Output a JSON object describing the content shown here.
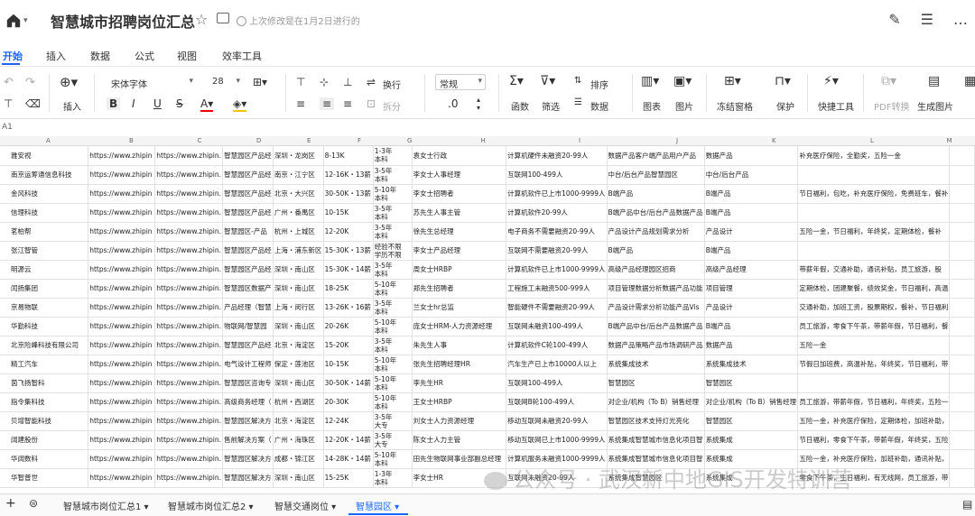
{
  "title": "智慧城市招聘岗位汇总",
  "save_status": "上次修改是在1月2日进行的",
  "menu": [
    "开始",
    "插入",
    "数据",
    "公式",
    "视图",
    "效率工具"
  ],
  "toolbar": {
    "insert": "插入",
    "font": "宋体字体",
    "size": "28",
    "wrap": "换行",
    "split": "拆分",
    "format": "常规",
    "decimal": ".0",
    "func": "函数",
    "filter": "筛选",
    "sort": "排序",
    "data": "数据",
    "chart": "图表",
    "image": "图片",
    "freeze": "冻结窗格",
    "protect": "保护",
    "quick": "快捷工具",
    "pdf": "PDF转换",
    "genimg": "生成图片"
  },
  "cell_ref": "A1",
  "columns": [
    "A",
    "B",
    "C",
    "D",
    "E",
    "F",
    "G",
    "H",
    "I",
    "J",
    "K",
    "L",
    "M"
  ],
  "rows": [
    [
      "雅安视",
      "https://www.zhipin",
      "https://www.zhipin.",
      "智慧园区产品经",
      "深圳・龙岗区",
      "8-13K",
      "1-3年\n本科",
      "袁女士行政",
      "计算机硬件未融资20-99人",
      "数据产品客户端产品用户产品",
      "数据产品",
      "补充医疗保险，全勤奖，五险一金",
      ""
    ],
    [
      "南京运筹通信息科技",
      "https://www.zhipin",
      "https://www.zhipin.",
      "智慧园区产品经",
      "南京・江宁区",
      "12-16K・13薪",
      "3-5年\n本科",
      "李女士人事经理",
      "互联网100-499人",
      "中台/后台产品智慧园区",
      "中台/后台产品",
      "",
      ""
    ],
    [
      "金风科技",
      "https://www.zhipin",
      "https://www.zhipin.",
      "智慧园区产品经",
      "北京・大兴区",
      "30-50K・13薪",
      "5-10年\n本科",
      "李女士招聘者",
      "计算机软件已上市1000-9999人",
      "B端产品",
      "B端产品",
      "节日福利，包吃，补充医疗保险，免费班车，餐补",
      ""
    ],
    [
      "信理科技",
      "https://www.zhipin",
      "https://www.zhipin.",
      "智慧园区产品经",
      "广州・番禺区",
      "10-15K",
      "3-5年\n本科",
      "苏先生人事主管",
      "计算机软件20-99人",
      "B端产品中台/后台产品数据产品",
      "B端产品",
      "",
      ""
    ],
    [
      "茗柏帮",
      "https://www.zhipin",
      "https://www.zhipin.",
      "智慧园区-产品",
      "杭州・上城区",
      "12-20K",
      "3-5年\n本科",
      "徐先生总经理",
      "电子商务不需要融资20-99人",
      "产品设计产品规划需求分析",
      "产品设计",
      "五险一金，节日福利，年终奖，定期体检，餐补",
      ""
    ],
    [
      "张江智管",
      "https://www.zhipin",
      "https://www.zhipin.",
      "智慧园区产品经",
      "上海・浦东新区",
      "15-30K・13薪",
      "经验不限\n学历不限",
      "李女士产品经理",
      "互联网不需要融资20-99人",
      "B端产品",
      "B端产品",
      "",
      ""
    ],
    [
      "明源云",
      "https://www.zhipin",
      "https://www.zhipin.",
      "智慧园区产品经",
      "深圳・南山区",
      "15-30K・14薪",
      "3-5年\n本科",
      "周女士HRBP",
      "计算机软件已上市1000-9999人",
      "高级产品经理园区招商",
      "高级产品经理",
      "带薪年假，交通补助，通讯补贴，员工旅游，股",
      ""
    ],
    [
      "闰扬集团",
      "https://www.zhipin",
      "https://www.zhipin.",
      "智慧园区数据产",
      "深圳・南山区",
      "18-25K",
      "5-10年\n本科",
      "郑先生招聘者",
      "工程施工未融资500-999人",
      "项目管理数据分析数据产品功能",
      "项目管理",
      "定期体检，团建聚餐，绩效奖金，节日福利，高温",
      ""
    ],
    [
      "京易物联",
      "https://www.zhipin",
      "https://www.zhipin.",
      "产品经理（智慧",
      "上海・闵行区",
      "13-26K・16薪",
      "3-5年\n本科",
      "兰女士hr总监",
      "智能硬件不需要融资20-99人",
      "产品设计需求分析功能产品Vis",
      "产品设计",
      "交通补助，加班工资，股票期权，餐补，节日福利",
      ""
    ],
    [
      "华勤科技",
      "https://www.zhipin",
      "https://www.zhipin.",
      "物联网/智慧园",
      "深圳・南山区",
      "20-26K",
      "5-10年\n本科",
      "庞女士HRM-人力资源经理",
      "互联网未融资100-499人",
      "B端产品中台/后台产品数据产品",
      "B端产品",
      "员工旅游，零食下午茶，带薪年假，节日福利，餐",
      ""
    ],
    [
      "北京险峰科技有限公司",
      "https://www.zhipin",
      "https://www.zhipin.",
      "智慧园区产品经",
      "北京・海淀区",
      "15-20K",
      "3-5年\n本科",
      "朱先生人事",
      "计算机软件C轮100-499人",
      "数据产品策略产品市场调研产品",
      "数据产品",
      "五险一金",
      ""
    ],
    [
      "精工汽车",
      "https://www.zhipin",
      "https://www.zhipin.",
      "电气设计工程师",
      "保定・莲池区",
      "10-15K",
      "5-10年\n本科",
      "张先生招聘经理HR",
      "汽车生产已上市10000人以上",
      "系统集成技术",
      "系统集成技术",
      "节假日加班费，高温补贴，年终奖，节日福利，带",
      ""
    ],
    [
      "茵飞扬智科",
      "https://www.zhipin",
      "https://www.zhipin.",
      "智慧园区咨询专",
      "深圳・南山区",
      "30-50K・14薪",
      "5-10年\n本科",
      "李先生HR",
      "互联网100-499人",
      "智慧园区",
      "智慧园区",
      "",
      ""
    ],
    [
      "指令集科技",
      "https://www.zhipin",
      "https://www.zhipin.",
      "高级商务经理（",
      "杭州・西湖区",
      "20-30K",
      "5-10年\n本科",
      "王女士HRBP",
      "互联网B轮100-499人",
      "对企业/机构（To B）销售经理",
      "对企业/机构（To B）销售经理",
      "员工旅游，带薪年假，节日福利，年终奖，五险一",
      ""
    ],
    [
      "贝增智能科技",
      "https://www.zhipin",
      "https://www.zhipin.",
      "智慧园区解决方",
      "北京・海淀区",
      "12-24K",
      "3-5年\n大专",
      "刘女士人力资源经理",
      "移动互联网未融资20-99人",
      "智慧园区技术支持灯光亮化",
      "智慧园区",
      "五险一金，补充医疗保险，定期体检，加班补助，",
      ""
    ],
    [
      "阔建股份",
      "https://www.zhipin",
      "https://www.zhipin.",
      "售前解决方案（",
      "广州・海珠区",
      "12-20K・14薪",
      "3-5年\n大专",
      "陈女士人力主管",
      "移动互联网已上市1000-9999人",
      "系统集成智慧城市信息化项目智",
      "系统集成",
      "节日福利，零食下午茶，带薪年假，年终奖，五险",
      ""
    ],
    [
      "华阔数科",
      "https://www.zhipin",
      "https://www.zhipin.",
      "智慧园区解决方",
      "成都・锦江区",
      "14-28K・14薪",
      "5-10年\n本科",
      "田先生物联网事业部副总经理",
      "计算机服务未融资1000-9999人",
      "系统集成智慧城市信息化项目智",
      "系统集成",
      "五险一金，补充医疗保险，加班补助，通讯补贴，",
      ""
    ],
    [
      "华智普世",
      "https://www.zhipin",
      "https://www.zhipin.",
      "智慧园区解决方",
      "深圳・南山区",
      "15-25K",
      "1-3年\n本科",
      "李女士HR",
      "互联网未融资20-99人",
      "系统集成智慧园区",
      "系统集成",
      "零食下午茶，生日福利，有无线网，员工旅游，带",
      ""
    ]
  ],
  "sheet_tabs": [
    "智慧城市岗位汇总1",
    "智慧城市岗位汇总2",
    "智慧交通岗位",
    "智慧园区"
  ],
  "active_tab": "智慧园区",
  "watermark": "公众号 · 武汉新中地GIS开发特训营"
}
